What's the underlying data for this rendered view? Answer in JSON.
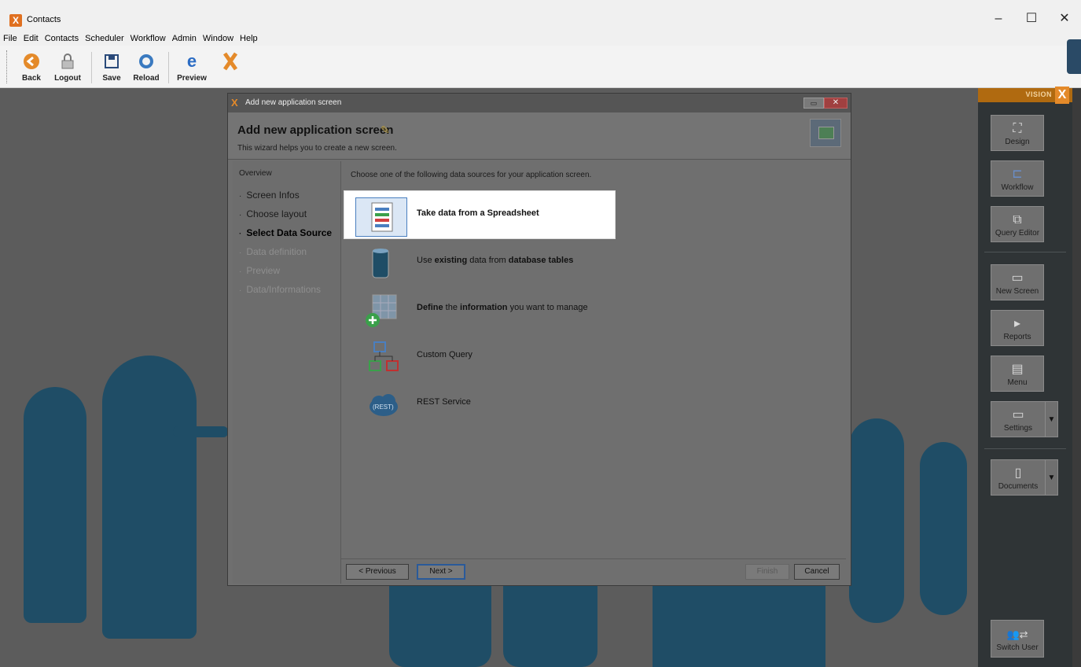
{
  "window": {
    "title": "Contacts",
    "controls": [
      "–",
      "☐",
      "✕"
    ]
  },
  "menu": [
    "File",
    "Edit",
    "Contacts",
    "Scheduler",
    "Workflow",
    "Admin",
    "Window",
    "Help"
  ],
  "toolbar": {
    "back": "Back",
    "logout": "Logout",
    "save": "Save",
    "reload": "Reload",
    "preview": "Preview"
  },
  "vision_panel": {
    "label": "VISION",
    "buttons": {
      "design": "Design",
      "workflow": "Workflow",
      "query_editor": "Query Editor",
      "new_screen": "New Screen",
      "reports": "Reports",
      "menu": "Menu",
      "settings": "Settings",
      "documents": "Documents",
      "switch_user": "Switch User"
    }
  },
  "dialog": {
    "window_title": "Add new application screen",
    "heading": "Add new application screen",
    "subtitle": "This wizard helps you to create a new screen.",
    "steps_title": "Overview",
    "steps": [
      "Screen Infos",
      "Choose layout",
      "Select Data Source",
      "Data definition",
      "Preview",
      "Data/Informations"
    ],
    "prompt": "Choose one of the following data sources for your application screen.",
    "options": {
      "spreadsheet": "Take data from a Spreadsheet",
      "db_pre": "Use ",
      "db_b1": "existing",
      "db_mid": " data from ",
      "db_b2": "database tables",
      "define_b1": "Define",
      "define_mid": " the ",
      "define_b2": "information",
      "define_post": " you want to manage",
      "custom_query": "Custom Query",
      "rest": "REST Service",
      "rest_badge": "(REST)"
    },
    "buttons": {
      "previous": "< Previous",
      "next": "Next >",
      "finish": "Finish",
      "cancel": "Cancel"
    }
  },
  "colors": {
    "accent": "#e48a2a",
    "selection_border": "#4a7fc0",
    "overlay": "#5c5c5c"
  }
}
